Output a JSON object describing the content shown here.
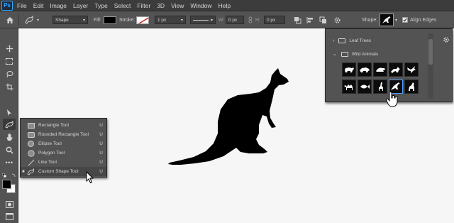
{
  "menubar": {
    "logo": "Ps",
    "items": [
      "File",
      "Edit",
      "Image",
      "Layer",
      "Type",
      "Select",
      "Filter",
      "3D",
      "View",
      "Window",
      "Help"
    ]
  },
  "options": {
    "mode_value": "Shape",
    "fill_label": "Fill:",
    "stroke_label": "Stroke:",
    "stroke_width": "1 px",
    "w_label": "W:",
    "w_value": "0 px",
    "h_label": "H:",
    "h_value": "0 px",
    "shape_label": "Shape:",
    "align_edges_label": "Align Edges",
    "align_edges_checked": true,
    "colors": {
      "fill": "#000000",
      "stroke_slash": "#d9231f"
    }
  },
  "flyout": {
    "items": [
      {
        "label": "Rectangle Tool",
        "key": "U",
        "icon": "rectangle-icon"
      },
      {
        "label": "Rounded Rectangle Tool",
        "key": "U",
        "icon": "rounded-rectangle-icon"
      },
      {
        "label": "Ellipse Tool",
        "key": "U",
        "icon": "ellipse-icon"
      },
      {
        "label": "Polygon Tool",
        "key": "U",
        "icon": "polygon-icon"
      },
      {
        "label": "Line Tool",
        "key": "U",
        "icon": "line-icon"
      },
      {
        "label": "Custom Shape Tool",
        "key": "U",
        "icon": "custom-shape-icon",
        "active": true
      }
    ]
  },
  "shape_picker": {
    "groups": [
      {
        "label": "Leaf Trees",
        "expanded": false
      },
      {
        "label": "Wild Animals",
        "expanded": true
      }
    ],
    "shapes": [
      "polar-bear",
      "boar",
      "turtle",
      "fox",
      "bird",
      "camel",
      "fish",
      "giraffe",
      "kangaroo",
      "horse"
    ],
    "selected_shape": "kangaroo"
  },
  "colors": {
    "menubar_bg": "#3c3c3c",
    "panel_bg": "#535353",
    "canvas_bg": "#f7f6f7",
    "selection_blue": "#4b9cf5",
    "shape_fill": "#000000"
  }
}
